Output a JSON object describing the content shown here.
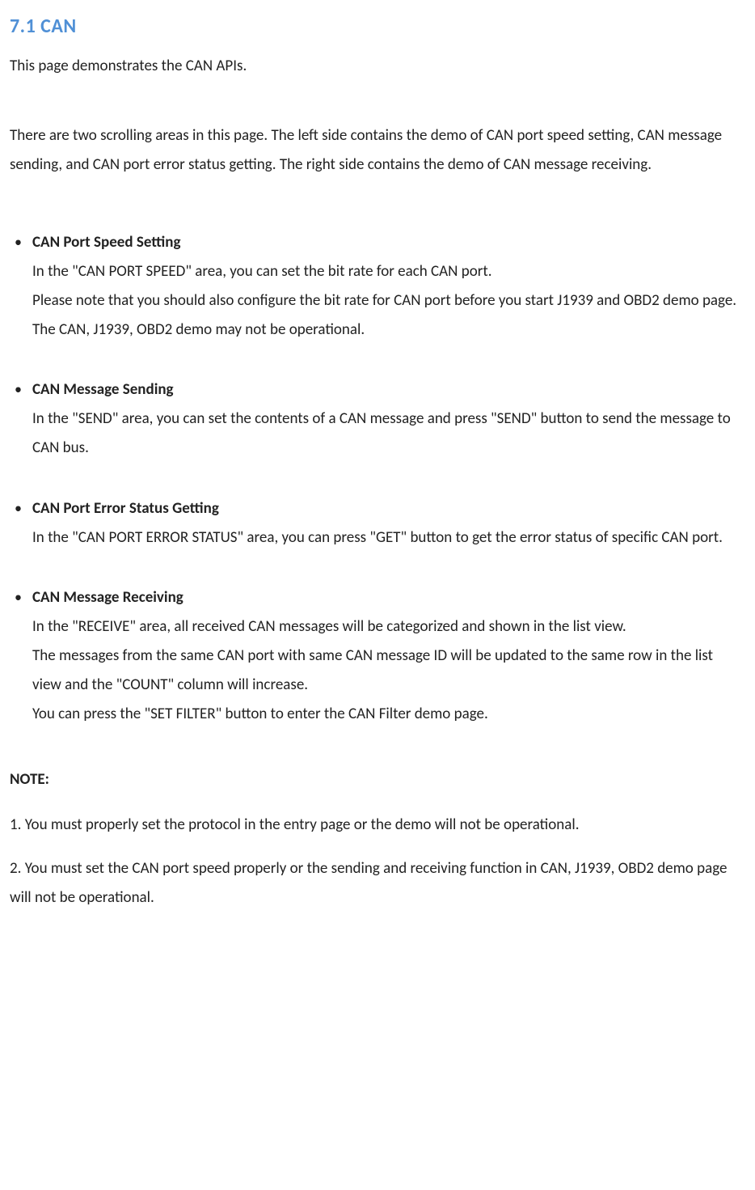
{
  "heading": "7.1 CAN",
  "intro": "This page demonstrates the CAN APIs.",
  "description": "There are two scrolling areas in this page. The left side contains the demo of CAN port speed setting, CAN message sending, and CAN port error status getting. The right side contains the demo of CAN message receiving.",
  "features": [
    {
      "title": "CAN Port Speed Setting",
      "body": "In the \"CAN PORT SPEED\" area, you can set the bit rate for each CAN port.\nPlease note that you should also configure the bit rate for CAN port before you start J1939 and OBD2 demo page.\nThe CAN, J1939, OBD2 demo may not be operational."
    },
    {
      "title": "CAN Message Sending",
      "body": "In the \"SEND\" area, you can set the contents of a CAN message and press \"SEND\" button to send the message to CAN bus."
    },
    {
      "title": "CAN Port Error Status Getting",
      "body": "In the \"CAN PORT ERROR STATUS\" area, you can press \"GET\" button to get the error status of specific CAN port."
    },
    {
      "title": "CAN Message Receiving",
      "body": "In the \"RECEIVE\" area, all received CAN messages will be categorized and shown in the list view.\nThe messages from the same CAN port with same CAN message ID will be updated to the same row in the list view and the \"COUNT\" column will increase.\nYou can press the \"SET FILTER\" button to enter the CAN Filter demo page."
    }
  ],
  "note": {
    "label": "NOTE:",
    "items": [
      "1. You must properly set the protocol in the entry page or the demo will not be operational.",
      "2. You must set the CAN port speed properly or the sending and receiving function in CAN, J1939, OBD2 demo page will not be operational."
    ]
  }
}
